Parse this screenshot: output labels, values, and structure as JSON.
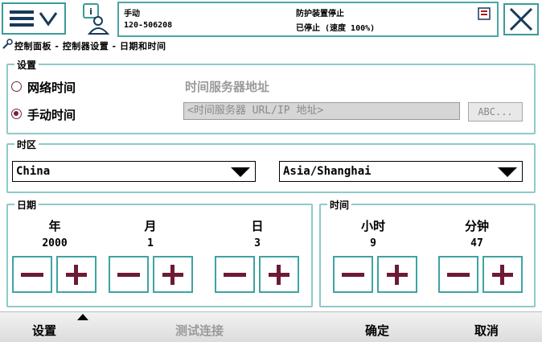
{
  "header": {
    "mode": "手动",
    "controller_id": "120-506208",
    "safety_status": "防护装置停止",
    "run_status": "已停止 (速度 100%)"
  },
  "breadcrumb": "控制面板 - 控制器设置 - 日期和时间",
  "settings": {
    "legend": "设置",
    "network_time_label": "网络时间",
    "manual_time_label": "手动时间",
    "server_addr_label": "时间服务器地址",
    "server_input_placeholder": "<时间服务器 URL/IP 地址>",
    "abc_button": "ABC..."
  },
  "timezone": {
    "legend": "时区",
    "region": "China",
    "zone": "Asia/Shanghai"
  },
  "date": {
    "legend": "日期",
    "year_label": "年",
    "year_value": "2000",
    "month_label": "月",
    "month_value": "1",
    "day_label": "日",
    "day_value": "3"
  },
  "time": {
    "legend": "时间",
    "hour_label": "小时",
    "hour_value": "9",
    "minute_label": "分钟",
    "minute_value": "47"
  },
  "bottom": {
    "settings": "设置",
    "test_connection": "测试连接",
    "ok": "确定",
    "cancel": "取消"
  },
  "colors": {
    "accent": "#3fa3a3",
    "button_glyph": "#6d1a36",
    "group_border": "#8fc9c9"
  }
}
